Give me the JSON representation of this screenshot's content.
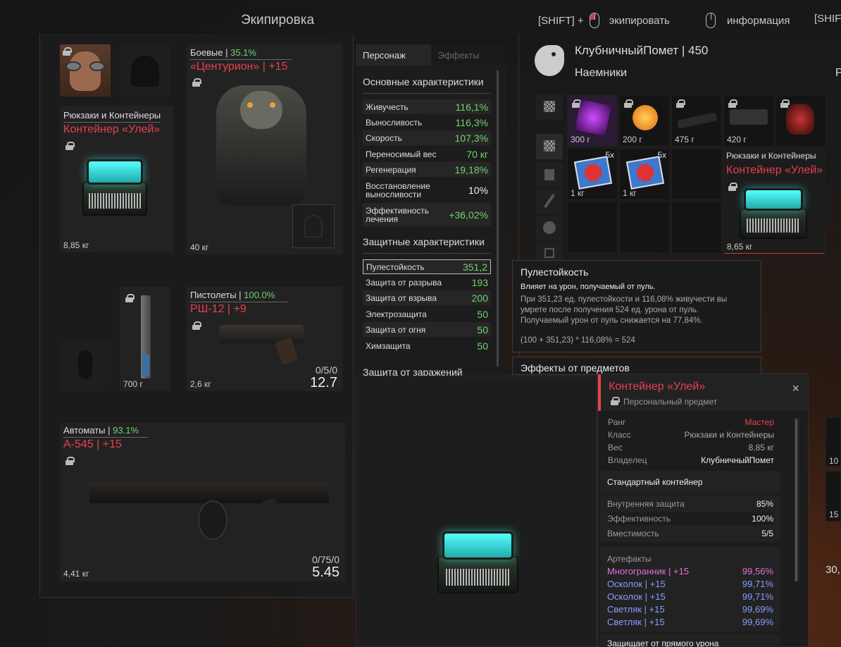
{
  "header": {
    "title": "Экипировка",
    "hint1_key": "[SHIFT] +",
    "hint1_text": "экипировать",
    "hint2_text": "информация",
    "hint3_key": "[SHIF"
  },
  "equip": {
    "backpack": {
      "category": "Рюкзаки и Контейнеры",
      "name": "Контейнер «Улей»",
      "weight": "8,85 кг"
    },
    "armor": {
      "category": "Боевые",
      "pct": "35.1%",
      "name": "«Центурион» | +15",
      "weight": "40 кг"
    },
    "melee": {
      "weight": "700 г"
    },
    "pistol": {
      "category": "Пистолеты",
      "pct": "100.0%",
      "name": "РШ-12 | +9",
      "weight": "2,6 кг",
      "ammo": "0/5/0",
      "damage": "12.7"
    },
    "rifle": {
      "category": "Автоматы",
      "pct": "93.1%",
      "name": "А-545 | +15",
      "weight": "4,41 кг",
      "ammo": "0/75/0",
      "damage": "5.45"
    }
  },
  "stats": {
    "tabs": [
      "Персонаж",
      "Эффекты"
    ],
    "main_title": "Основные характеристики",
    "main": [
      {
        "label": "Живучесть",
        "value": "116,1%"
      },
      {
        "label": "Выносливость",
        "value": "116,3%"
      },
      {
        "label": "Скорость",
        "value": "107,3%"
      },
      {
        "label": "Переносимый вес",
        "value": "70 кг"
      },
      {
        "label": "Регенерация",
        "value": "19,18%"
      },
      {
        "label": "Восстановление выносливости",
        "value": "10%"
      },
      {
        "label": "Эффективность лечения",
        "value": "+36,02%"
      }
    ],
    "def_title": "Защитные характеристики",
    "def": [
      {
        "label": "Пулестойкость",
        "value": "351,2"
      },
      {
        "label": "Защита от разрыва",
        "value": "193"
      },
      {
        "label": "Защита от взрыва",
        "value": "200"
      },
      {
        "label": "Электрозащита",
        "value": "50"
      },
      {
        "label": "Защита от огня",
        "value": "50"
      },
      {
        "label": "Химзащита",
        "value": "50"
      }
    ],
    "cut_title": "Защита от заражений"
  },
  "profile": {
    "name": "КлубничныйПомет | 450",
    "faction": "Наемники",
    "faction_cut": "Р"
  },
  "inventory": {
    "items": [
      {
        "weight": "300 г"
      },
      {
        "weight": "200 г"
      },
      {
        "weight": "475 г"
      },
      {
        "weight": "420 г"
      },
      {
        "weight": ""
      },
      {
        "weight": "1 кг",
        "count": "5х"
      },
      {
        "weight": "1 кг",
        "count": "5х"
      }
    ],
    "container": {
      "category": "Рюкзаки и Контейнеры",
      "name": "Контейнер «Улей»",
      "weight": "8,65 кг"
    },
    "edge_labels": [
      "10",
      "15",
      "30,"
    ]
  },
  "tooltip": {
    "title": "Пулестойкость",
    "subtitle": "Влияет на урон, получаемый от пуль.",
    "line1": "При 351,23 ед. пулестойкости и 116,08% живучести вы",
    "line2": "умрете после получения 524 ед. урона от пуль.",
    "line3": "Получаемый урон от пуль снижается на 77,84%.",
    "formula": "(100 + 351,23) * 116,08% = 524",
    "effects_title": "Эффекты от предметов"
  },
  "card": {
    "name": "Контейнер «Улей»",
    "personal": "Персональный предмет",
    "props": [
      {
        "k": "Ранг",
        "v": "Мастер"
      },
      {
        "k": "Класс",
        "v": "Рюкзаки и Контейнеры"
      },
      {
        "k": "Вес",
        "v": "8,85 кг"
      },
      {
        "k": "Владелец",
        "v": "КлубничныйПомет"
      }
    ],
    "type": "Стандартный контейнер",
    "params": [
      {
        "k": "Внутренняя защита",
        "v": "85%"
      },
      {
        "k": "Эффективность",
        "v": "100%"
      },
      {
        "k": "Вместимость",
        "v": "5/5"
      }
    ],
    "art_title": "Артефакты",
    "artifacts": [
      {
        "name": "Многогранник | +15",
        "pct": "99,56%"
      },
      {
        "name": "Осколок | +15",
        "pct": "99,71%"
      },
      {
        "name": "Осколок | +15",
        "pct": "99,71%"
      },
      {
        "name": "Светляк | +15",
        "pct": "99,69%"
      },
      {
        "name": "Светляк | +15",
        "pct": "99,69%"
      }
    ],
    "footer_cut": "Защищает от прямого урона"
  },
  "colors": {
    "accent_red": "#e5414f",
    "green": "#6fd36f",
    "pink": "#e070d8",
    "blue": "#8a9cff"
  }
}
